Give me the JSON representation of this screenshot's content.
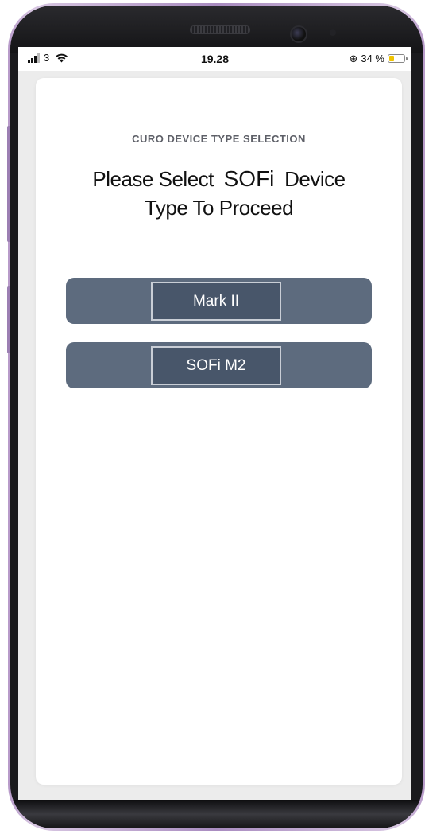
{
  "status_bar": {
    "carrier": "3",
    "time": "19.28",
    "battery_percent": "34 %",
    "battery_level": 0.34,
    "icons": [
      "signal-icon",
      "wifi-icon",
      "rotation-lock-icon",
      "battery-icon"
    ]
  },
  "screen": {
    "eyebrow": "CURO DEVICE TYPE SELECTION",
    "heading_part1": "Please Select",
    "heading_brand": "SOFi",
    "heading_part2": "Device",
    "heading_line2": "Type To Proceed",
    "options": [
      {
        "label": "Mark II"
      },
      {
        "label": "SOFi M2"
      }
    ]
  },
  "colors": {
    "option_bar": "#5d6b7e",
    "option_button": "#48566a",
    "battery": "#f0c400"
  }
}
